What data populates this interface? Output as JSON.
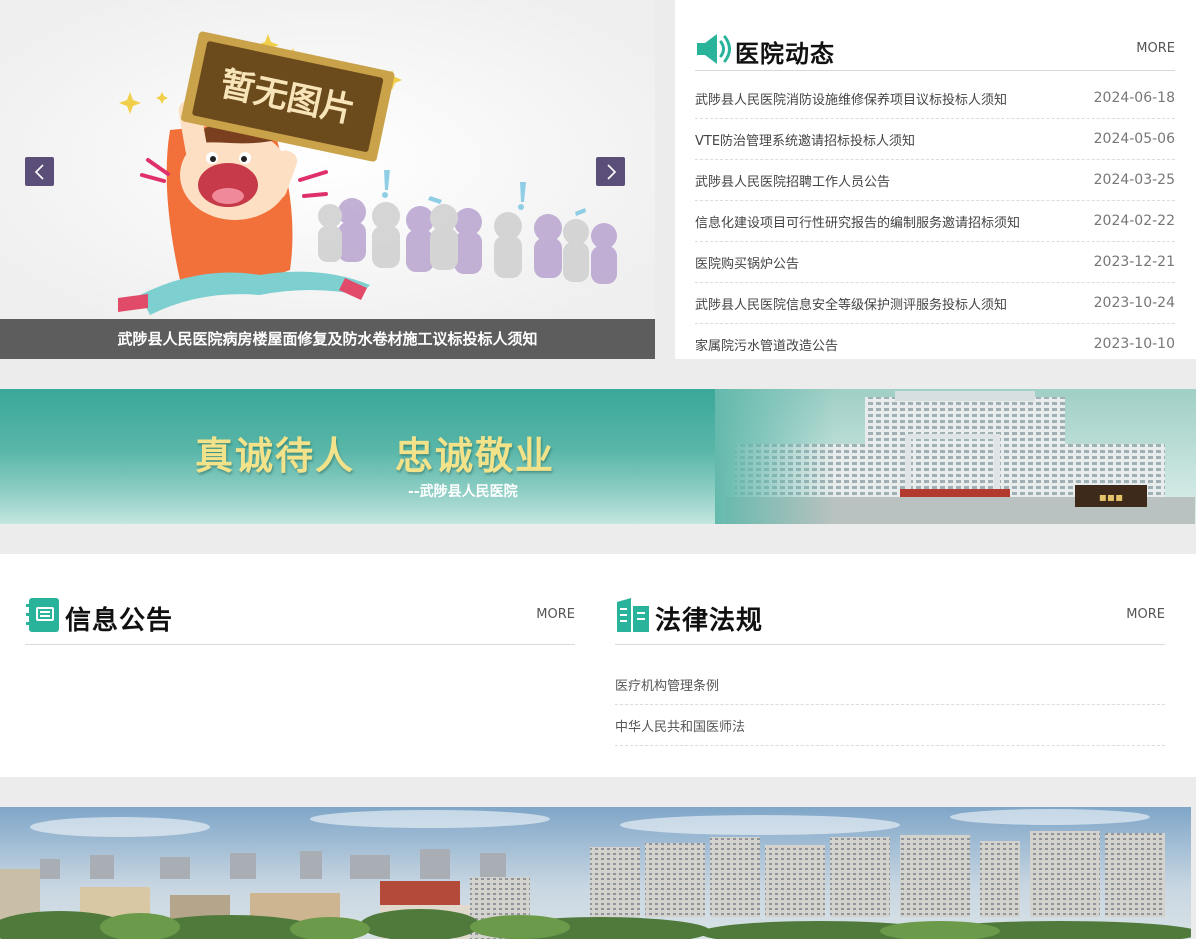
{
  "slider": {
    "placeholder_text": "暂无图片",
    "caption": "武陟县人民医院病房楼屋面修复及防水卷材施工议标投标人须知",
    "prev_icon": "chevron-left-icon",
    "next_icon": "chevron-right-icon"
  },
  "news": {
    "title": "医院动态",
    "more": "MORE",
    "icon": "speaker-icon",
    "items": [
      {
        "title": "武陟县人民医院消防设施维修保养项目议标投标人须知",
        "date": "2024-06-18"
      },
      {
        "title": "VTE防治管理系统邀请招标投标人须知",
        "date": "2024-05-06"
      },
      {
        "title": "武陟县人民医院招聘工作人员公告",
        "date": "2024-03-25"
      },
      {
        "title": "信息化建设项目可行性研究报告的编制服务邀请招标须知",
        "date": "2024-02-22"
      },
      {
        "title": "医院购买锅炉公告",
        "date": "2023-12-21"
      },
      {
        "title": "武陟县人民医院信息安全等级保护测评服务投标人须知",
        "date": "2023-10-24"
      },
      {
        "title": "家属院污水管道改造公告",
        "date": "2023-10-10"
      }
    ]
  },
  "banner": {
    "slogan": "真诚待人　忠诚敬业",
    "signature": "--武陟县人民医院"
  },
  "notice": {
    "title": "信息公告",
    "more": "MORE",
    "icon": "notebook-icon"
  },
  "law": {
    "title": "法律法规",
    "more": "MORE",
    "icon": "law-book-icon",
    "items": [
      {
        "title": "医疗机构管理条例"
      },
      {
        "title": "中华人民共和国医师法"
      }
    ]
  },
  "colors": {
    "accent_teal": "#2ab39b",
    "arrow_purple": "#5b4e78",
    "slogan_yellow": "#f2e28a"
  }
}
